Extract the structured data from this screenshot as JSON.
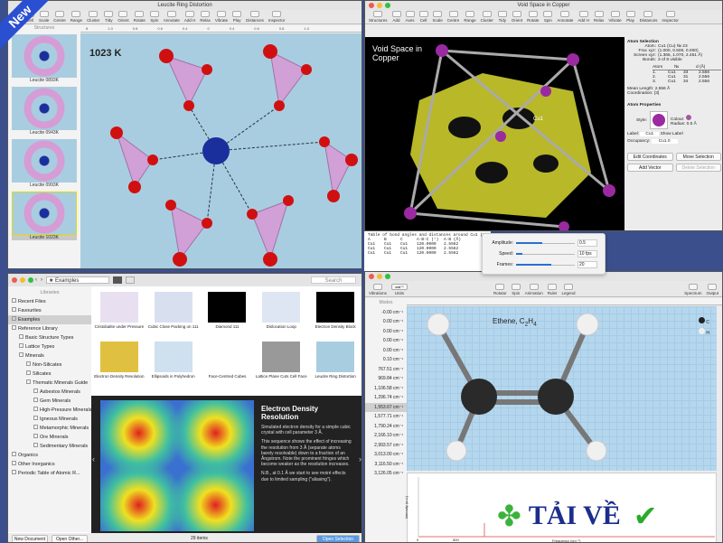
{
  "badge": {
    "label": "New"
  },
  "win1": {
    "title": "Leucite Ring Distortion",
    "toolbar": [
      "Axes",
      "Cell",
      "Scale",
      "Centre",
      "Range",
      "Cluster",
      "Tidy",
      "Orient",
      "Rotate",
      "Spin",
      "Annotate",
      "Add H",
      "Relax",
      "Vibrate",
      "Play",
      "Distances",
      "Inspector"
    ],
    "sidebar_header": "Structures",
    "thumbs": [
      "Leucite 0893K",
      "Leucite 0943K",
      "Leucite 0993K",
      "Leucite 1023K"
    ],
    "temp": "1023 K",
    "ruler": [
      "8",
      "1.0",
      "0.8",
      "0.6",
      "0.4",
      "0",
      "0.4",
      "0.6",
      "0.8",
      "1.0"
    ]
  },
  "win2": {
    "title": "Void Space in Copper",
    "toolbar": [
      "Structures",
      "Add",
      "Axes",
      "Cell",
      "Scale",
      "Centre",
      "Range",
      "Cluster",
      "Tidy",
      "Orient",
      "Rotate",
      "Spin",
      "Annotate",
      "Add H",
      "Relax",
      "Vibrate",
      "Play",
      "Distances",
      "Inspector"
    ],
    "view_title": "Void Space in Copper",
    "atom_label": "Cu1",
    "inspector": {
      "atom_selection": "Atom Selection",
      "rows": [
        [
          "Atom:",
          "Cu1 (Cu) № 23"
        ],
        [
          "Frac xyz:",
          "(1.000, 0.500, 0.000)"
        ],
        [
          "Screen xyz:",
          "(1.365, 1.070, 2.451 Å)"
        ],
        [
          "Bonds:",
          "3 of 8 visible"
        ]
      ],
      "table_head": [
        "Atom",
        "№",
        "d (Å)"
      ],
      "table": [
        [
          "1.",
          "Cu1",
          "33",
          "2.556"
        ],
        [
          "2.",
          "Cu1",
          "31",
          "2.556"
        ],
        [
          "3.",
          "Cu1",
          "34",
          "2.556"
        ]
      ],
      "mean_length": [
        "Mean Length:",
        "2.556 Å"
      ],
      "coordination": [
        "Coordination:",
        "[3]"
      ],
      "atom_properties": "Atom Properties",
      "style": "Style:",
      "colour": "Colour:",
      "radius": "Radius:",
      "radius_value": "0.5 Å",
      "label": "Label:",
      "label_value": "Cu1",
      "show_label": "Show Label",
      "occupancy": "Occupancy:",
      "occupancy_value": "Cu1.0",
      "buttons": [
        "Edit Coordinates",
        "Move Selection",
        "Add Vector",
        "Delete Selection"
      ]
    },
    "bond_table": {
      "title": "Table of bond angles and distances around Cu1 (0",
      "head": [
        "A",
        "B",
        "C",
        "A-B-C (°)",
        "A-B (Å)"
      ],
      "rows": [
        [
          "Cu1",
          "Cu1",
          "Cu1",
          "120.0000",
          "2.5562"
        ],
        [
          "Cu1",
          "Cu1",
          "Cu1",
          "120.0000",
          "2.5562"
        ],
        [
          "Cu1",
          "Cu1",
          "Cu1",
          "120.0000",
          "2.5562"
        ]
      ]
    }
  },
  "popover": {
    "amplitude": "Amplitude:",
    "amplitude_value": "0.5",
    "amplitude_level": 0.45,
    "speed": "Speed:",
    "speed_value": "10 fps",
    "speed_level": 0.1,
    "frames": "Frames:",
    "frames_value": "20",
    "frames_level": 0.6
  },
  "win3": {
    "search_placeholder": "Search",
    "location": "Examples",
    "libraries": "Libraries",
    "tree": [
      {
        "label": "Recent Files",
        "indent": 0
      },
      {
        "label": "Favourites",
        "indent": 0
      },
      {
        "label": "Examples",
        "indent": 0,
        "selected": true
      },
      {
        "label": "Reference Library",
        "indent": 0
      },
      {
        "label": "Basic Structure Types",
        "indent": 1
      },
      {
        "label": "Lattice Types",
        "indent": 1
      },
      {
        "label": "Minerals",
        "indent": 1
      },
      {
        "label": "Non-Silicates",
        "indent": 2
      },
      {
        "label": "Silicates",
        "indent": 2
      },
      {
        "label": "Thematic Minerals Guide",
        "indent": 2
      },
      {
        "label": "Asbestos Minerals",
        "indent": 3
      },
      {
        "label": "Gem Minerals",
        "indent": 3
      },
      {
        "label": "High-Pressure Minerals",
        "indent": 3
      },
      {
        "label": "Igneous Minerals",
        "indent": 3
      },
      {
        "label": "Metamorphic Minerals",
        "indent": 3
      },
      {
        "label": "Ore Minerals",
        "indent": 3
      },
      {
        "label": "Sedimentary Minerals",
        "indent": 3
      },
      {
        "label": "Organics",
        "indent": 0
      },
      {
        "label": "Other Inorganics",
        "indent": 0
      },
      {
        "label": "Periodic Table of Atomic R...",
        "indent": 0
      }
    ],
    "examples": [
      "Cristobalite under Pressure",
      "Cubic Close Packing on 111",
      "Diamond 111",
      "Dislocation Loop",
      "Electron Density Block",
      "Electron Density Resolution",
      "Ellipsoids in Polyhedron",
      "Face-Centred Cubes",
      "Lattice Plane Cuts Cell Face",
      "Leucite Ring Distortion"
    ],
    "detail_title": "Electron Density Resolution",
    "detail_p1": "Simulated electron density for a simple cubic crystal with cell parameter 3 Å.",
    "detail_p2": "This sequence shows the effect of increasing the resolution from 3 Å (separate atoms barely resolvable) down to a fraction of an Ångstrom. Note the prominent fringes which become weaker as the resolution increases.",
    "detail_p3": "N.B., at 0.1 Å we start to see moiré effects due to limited sampling (\"aliasing\").",
    "count": "29 items",
    "new_document": "New Document",
    "open_other": "Open Other...",
    "open_selection": "Open Selection"
  },
  "win4": {
    "toolbar_left": [
      "Vibrations",
      "Units"
    ],
    "units_value": "cm⁻¹",
    "toolbar_mid": [
      "Rotator",
      "Spin",
      "Animation",
      "Ruler",
      "Legend"
    ],
    "toolbar_right": [
      "Spectrum",
      "Output"
    ],
    "modes_header": "Modes",
    "modes": [
      "-0.00 cm⁻¹",
      "0.00 cm⁻¹",
      "0.00 cm⁻¹",
      "0.00 cm⁻¹",
      "0.00 cm⁻¹",
      "0.10 cm⁻¹",
      "767.51 cm⁻¹",
      "969.84 cm⁻¹",
      "1,106.58 cm⁻¹",
      "1,296.74 cm⁻¹",
      "1,553.67 cm⁻¹",
      "1,577.71 cm⁻¹",
      "1,790.24 cm⁻¹",
      "2,166.10 cm⁻¹",
      "2,993.57 cm⁻¹",
      "3,013.00 cm⁻¹",
      "3,116.50 cm⁻¹",
      "3,126.05 cm⁻¹"
    ],
    "selected_mode": 10,
    "molecule_title": "Ethene, C",
    "molecule_sub1": "2",
    "molecule_h": "H",
    "molecule_sub2": "4",
    "legend": [
      "C",
      "H"
    ],
    "spectrum_xlabel": "Frequency (cm⁻¹)",
    "spectrum_ylabel": "Intensity (a.u.)",
    "spectrum_ticks": [
      "0",
      "500"
    ]
  },
  "watermark": {
    "text": "TẢI VỀ"
  },
  "colors": {
    "background": "#3b4f8c",
    "viewport_blue": "#a9cde0",
    "oxygen": "#d01010",
    "potassium": "#1a2f9c",
    "copper": "#9a2aa0",
    "void": "#e0e030",
    "badge": "#2a4fd0"
  }
}
